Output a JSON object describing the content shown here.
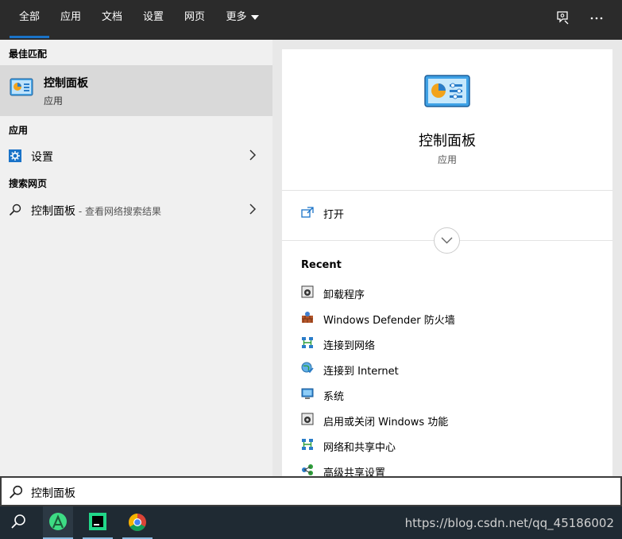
{
  "tabs": [
    {
      "label": "全部",
      "active": true
    },
    {
      "label": "应用"
    },
    {
      "label": "文档"
    },
    {
      "label": "设置"
    },
    {
      "label": "网页"
    },
    {
      "label": "更多"
    }
  ],
  "top_icons": [
    "feedback-icon",
    "more-icon"
  ],
  "left": {
    "best_match_heading": "最佳匹配",
    "best_match": {
      "title": "控制面板",
      "subtitle": "应用",
      "icon": "control-panel-icon"
    },
    "apps_heading": "应用",
    "apps": [
      {
        "label": "设置",
        "icon": "settings-gear-icon"
      }
    ],
    "web_heading": "搜索网页",
    "web": [
      {
        "label": "控制面板",
        "suffix": " - 查看网络搜索结果",
        "icon": "search-icon"
      }
    ]
  },
  "right": {
    "title": "控制面板",
    "subtitle": "应用",
    "actions": [
      {
        "label": "打开",
        "icon": "open-icon"
      }
    ],
    "recent_heading": "Recent",
    "recent": [
      {
        "label": "卸载程序",
        "icon": "programs-icon"
      },
      {
        "label": "Windows Defender 防火墙",
        "icon": "firewall-icon"
      },
      {
        "label": "连接到网络",
        "icon": "network-icon"
      },
      {
        "label": "连接到 Internet",
        "icon": "internet-icon"
      },
      {
        "label": "系统",
        "icon": "system-icon"
      },
      {
        "label": "启用或关闭 Windows 功能",
        "icon": "programs-icon"
      },
      {
        "label": "网络和共享中心",
        "icon": "network-icon"
      },
      {
        "label": "高级共享设置",
        "icon": "sharing-icon"
      }
    ]
  },
  "search": {
    "value": "控制面板"
  },
  "taskbar": {
    "apps": [
      "android-studio-icon",
      "pycharm-icon",
      "chrome-icon"
    ],
    "watermark": "https://blog.csdn.net/qq_45186002"
  },
  "colors": {
    "accent": "#1a73c8",
    "topbar": "#2b2b2b",
    "taskbar": "#1f2a33"
  }
}
